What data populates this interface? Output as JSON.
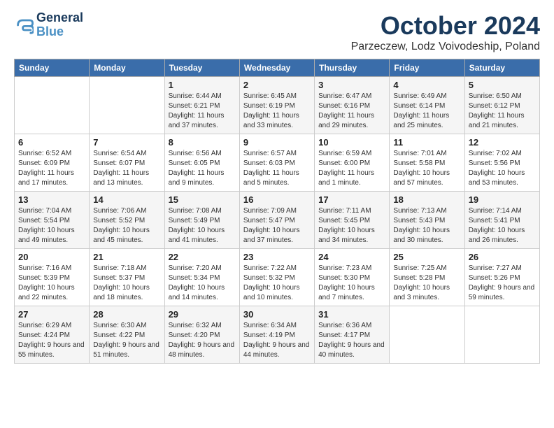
{
  "logo": {
    "line1": "General",
    "line2": "Blue"
  },
  "title": "October 2024",
  "subtitle": "Parzeczew, Lodz Voivodeship, Poland",
  "headers": [
    "Sunday",
    "Monday",
    "Tuesday",
    "Wednesday",
    "Thursday",
    "Friday",
    "Saturday"
  ],
  "weeks": [
    [
      {
        "day": "",
        "info": ""
      },
      {
        "day": "",
        "info": ""
      },
      {
        "day": "1",
        "info": "Sunrise: 6:44 AM\nSunset: 6:21 PM\nDaylight: 11 hours and 37 minutes."
      },
      {
        "day": "2",
        "info": "Sunrise: 6:45 AM\nSunset: 6:19 PM\nDaylight: 11 hours and 33 minutes."
      },
      {
        "day": "3",
        "info": "Sunrise: 6:47 AM\nSunset: 6:16 PM\nDaylight: 11 hours and 29 minutes."
      },
      {
        "day": "4",
        "info": "Sunrise: 6:49 AM\nSunset: 6:14 PM\nDaylight: 11 hours and 25 minutes."
      },
      {
        "day": "5",
        "info": "Sunrise: 6:50 AM\nSunset: 6:12 PM\nDaylight: 11 hours and 21 minutes."
      }
    ],
    [
      {
        "day": "6",
        "info": "Sunrise: 6:52 AM\nSunset: 6:09 PM\nDaylight: 11 hours and 17 minutes."
      },
      {
        "day": "7",
        "info": "Sunrise: 6:54 AM\nSunset: 6:07 PM\nDaylight: 11 hours and 13 minutes."
      },
      {
        "day": "8",
        "info": "Sunrise: 6:56 AM\nSunset: 6:05 PM\nDaylight: 11 hours and 9 minutes."
      },
      {
        "day": "9",
        "info": "Sunrise: 6:57 AM\nSunset: 6:03 PM\nDaylight: 11 hours and 5 minutes."
      },
      {
        "day": "10",
        "info": "Sunrise: 6:59 AM\nSunset: 6:00 PM\nDaylight: 11 hours and 1 minute."
      },
      {
        "day": "11",
        "info": "Sunrise: 7:01 AM\nSunset: 5:58 PM\nDaylight: 10 hours and 57 minutes."
      },
      {
        "day": "12",
        "info": "Sunrise: 7:02 AM\nSunset: 5:56 PM\nDaylight: 10 hours and 53 minutes."
      }
    ],
    [
      {
        "day": "13",
        "info": "Sunrise: 7:04 AM\nSunset: 5:54 PM\nDaylight: 10 hours and 49 minutes."
      },
      {
        "day": "14",
        "info": "Sunrise: 7:06 AM\nSunset: 5:52 PM\nDaylight: 10 hours and 45 minutes."
      },
      {
        "day": "15",
        "info": "Sunrise: 7:08 AM\nSunset: 5:49 PM\nDaylight: 10 hours and 41 minutes."
      },
      {
        "day": "16",
        "info": "Sunrise: 7:09 AM\nSunset: 5:47 PM\nDaylight: 10 hours and 37 minutes."
      },
      {
        "day": "17",
        "info": "Sunrise: 7:11 AM\nSunset: 5:45 PM\nDaylight: 10 hours and 34 minutes."
      },
      {
        "day": "18",
        "info": "Sunrise: 7:13 AM\nSunset: 5:43 PM\nDaylight: 10 hours and 30 minutes."
      },
      {
        "day": "19",
        "info": "Sunrise: 7:14 AM\nSunset: 5:41 PM\nDaylight: 10 hours and 26 minutes."
      }
    ],
    [
      {
        "day": "20",
        "info": "Sunrise: 7:16 AM\nSunset: 5:39 PM\nDaylight: 10 hours and 22 minutes."
      },
      {
        "day": "21",
        "info": "Sunrise: 7:18 AM\nSunset: 5:37 PM\nDaylight: 10 hours and 18 minutes."
      },
      {
        "day": "22",
        "info": "Sunrise: 7:20 AM\nSunset: 5:34 PM\nDaylight: 10 hours and 14 minutes."
      },
      {
        "day": "23",
        "info": "Sunrise: 7:22 AM\nSunset: 5:32 PM\nDaylight: 10 hours and 10 minutes."
      },
      {
        "day": "24",
        "info": "Sunrise: 7:23 AM\nSunset: 5:30 PM\nDaylight: 10 hours and 7 minutes."
      },
      {
        "day": "25",
        "info": "Sunrise: 7:25 AM\nSunset: 5:28 PM\nDaylight: 10 hours and 3 minutes."
      },
      {
        "day": "26",
        "info": "Sunrise: 7:27 AM\nSunset: 5:26 PM\nDaylight: 9 hours and 59 minutes."
      }
    ],
    [
      {
        "day": "27",
        "info": "Sunrise: 6:29 AM\nSunset: 4:24 PM\nDaylight: 9 hours and 55 minutes."
      },
      {
        "day": "28",
        "info": "Sunrise: 6:30 AM\nSunset: 4:22 PM\nDaylight: 9 hours and 51 minutes."
      },
      {
        "day": "29",
        "info": "Sunrise: 6:32 AM\nSunset: 4:20 PM\nDaylight: 9 hours and 48 minutes."
      },
      {
        "day": "30",
        "info": "Sunrise: 6:34 AM\nSunset: 4:19 PM\nDaylight: 9 hours and 44 minutes."
      },
      {
        "day": "31",
        "info": "Sunrise: 6:36 AM\nSunset: 4:17 PM\nDaylight: 9 hours and 40 minutes."
      },
      {
        "day": "",
        "info": ""
      },
      {
        "day": "",
        "info": ""
      }
    ]
  ]
}
